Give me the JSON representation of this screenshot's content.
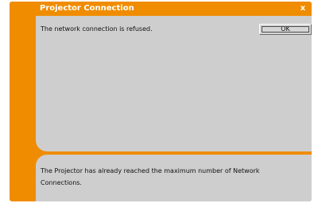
{
  "window": {
    "title": "Projector Connection",
    "close_label": "x"
  },
  "top_panel": {
    "message": "The network connection is refused.",
    "ok_label": "OK"
  },
  "bottom_panel": {
    "message": "The Projector has already reached the maximum number of Network Connections."
  },
  "colors": {
    "frame": "#f08c00",
    "panel": "#cecece",
    "title_text": "#ffffff"
  }
}
